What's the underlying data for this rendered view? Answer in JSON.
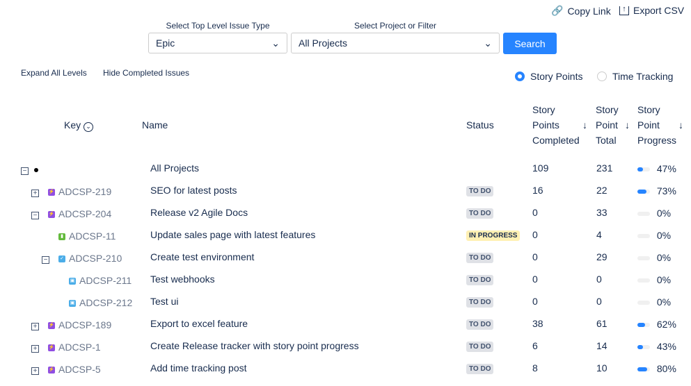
{
  "toolbar": {
    "copy_link": "Copy Link",
    "export_csv": "Export CSV"
  },
  "filters": {
    "type_label": "Select Top Level Issue Type",
    "type_value": "Epic",
    "project_label": "Select Project or Filter",
    "project_value": "All Projects",
    "search": "Search"
  },
  "actions": {
    "expand": "Expand All Levels",
    "hide": "Hide Completed Issues"
  },
  "mode": {
    "story_points": "Story Points",
    "time_tracking": "Time Tracking",
    "selected": "story_points"
  },
  "columns": {
    "key": "Key",
    "name": "Name",
    "status": "Status",
    "completed": [
      "Story",
      "Points",
      "Completed"
    ],
    "total": [
      "Story",
      "Point",
      "Total"
    ],
    "progress": [
      "Story",
      "Point",
      "Progress"
    ]
  },
  "rows": [
    {
      "key": "",
      "name": "All Projects",
      "status": "",
      "completed": "109",
      "total": "231",
      "progress": 47,
      "progress_label": "47%",
      "level": 0,
      "toggle": "−",
      "type": "root"
    },
    {
      "key": "ADCSP-219",
      "name": "SEO for latest posts",
      "status": "TO DO",
      "completed": "16",
      "total": "22",
      "progress": 73,
      "progress_label": "73%",
      "level": 1,
      "toggle": "+",
      "type": "epic"
    },
    {
      "key": "ADCSP-204",
      "name": "Release v2 Agile Docs",
      "status": "TO DO",
      "completed": "0",
      "total": "33",
      "progress": 0,
      "progress_label": "0%",
      "level": 1,
      "toggle": "−",
      "type": "epic"
    },
    {
      "key": "ADCSP-11",
      "name": "Update sales page with latest features",
      "status": "IN PROGRESS",
      "completed": "0",
      "total": "4",
      "progress": 0,
      "progress_label": "0%",
      "level": 2,
      "toggle": "",
      "type": "story"
    },
    {
      "key": "ADCSP-210",
      "name": "Create test environment",
      "status": "TO DO",
      "completed": "0",
      "total": "29",
      "progress": 0,
      "progress_label": "0%",
      "level": 2,
      "toggle": "−",
      "type": "task"
    },
    {
      "key": "ADCSP-211",
      "name": "Test webhooks",
      "status": "TO DO",
      "completed": "0",
      "total": "0",
      "progress": 0,
      "progress_label": "0%",
      "level": 3,
      "toggle": "",
      "type": "subtask"
    },
    {
      "key": "ADCSP-212",
      "name": "Test ui",
      "status": "TO DO",
      "completed": "0",
      "total": "0",
      "progress": 0,
      "progress_label": "0%",
      "level": 3,
      "toggle": "",
      "type": "subtask"
    },
    {
      "key": "ADCSP-189",
      "name": "Export to excel feature",
      "status": "TO DO",
      "completed": "38",
      "total": "61",
      "progress": 62,
      "progress_label": "62%",
      "level": 1,
      "toggle": "+",
      "type": "epic"
    },
    {
      "key": "ADCSP-1",
      "name": "Create Release tracker with story point progress",
      "status": "TO DO",
      "completed": "6",
      "total": "14",
      "progress": 43,
      "progress_label": "43%",
      "level": 1,
      "toggle": "+",
      "type": "epic"
    },
    {
      "key": "ADCSP-5",
      "name": "Add time tracking post",
      "status": "TO DO",
      "completed": "8",
      "total": "10",
      "progress": 80,
      "progress_label": "80%",
      "level": 1,
      "toggle": "+",
      "type": "epic"
    }
  ]
}
